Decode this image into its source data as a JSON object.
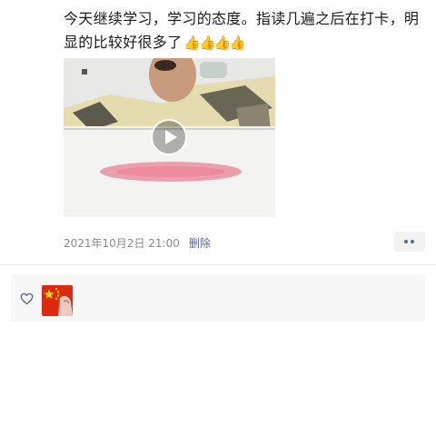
{
  "post": {
    "text": "今天继续学习，学习的态度。指读几遍之后在打卡，明显的比较好很多了",
    "emoji": "👍👍👍👍",
    "timestamp": "2021年10月2日 21:00",
    "delete_label": "删除"
  },
  "video": {
    "play_icon": "play-icon"
  },
  "more_button": {
    "icon": "more-dots-icon"
  },
  "likes": {
    "heart_icon": "heart-outline-icon",
    "avatar_icon": "flag-avatar"
  },
  "colors": {
    "link_blue": "#576b95",
    "meta_gray": "#8a8a8a",
    "panel_bg": "#f7f7f7",
    "flag_red": "#de2910",
    "flag_yellow": "#ffde00"
  }
}
